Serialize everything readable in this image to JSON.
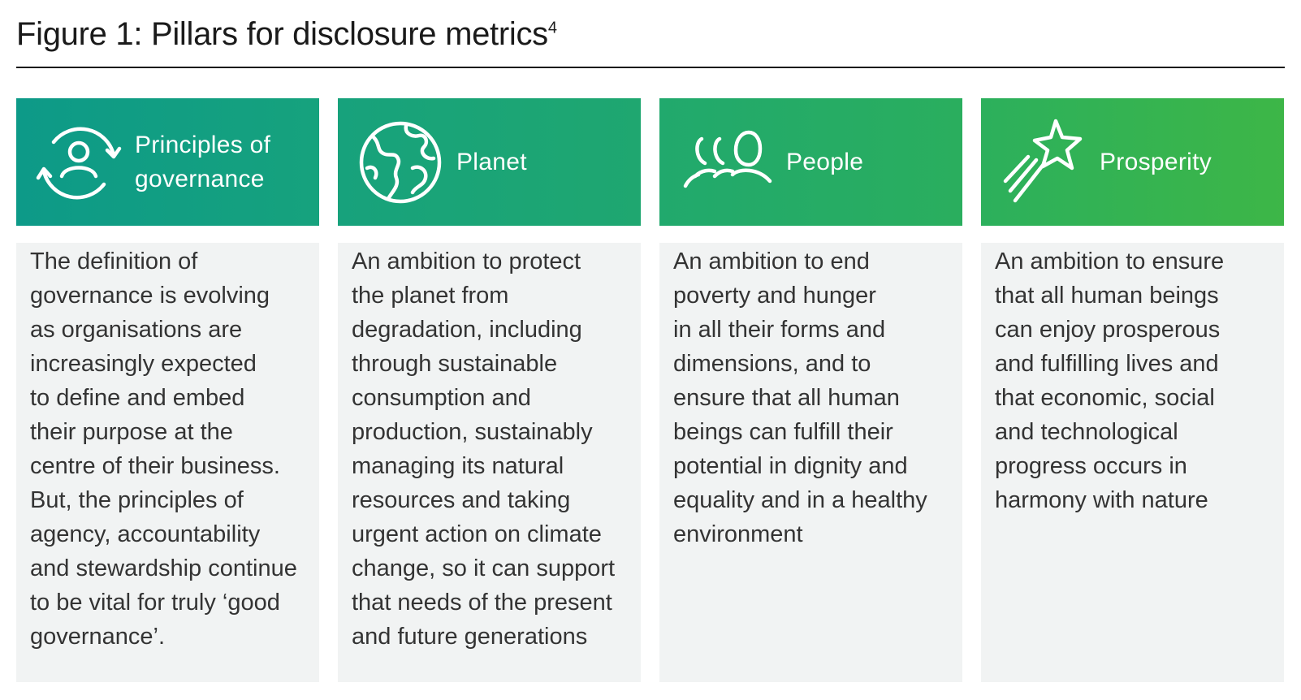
{
  "figure": {
    "title": "Figure 1: Pillars for disclosure metrics",
    "footnote_marker": "4"
  },
  "pillars": [
    {
      "heading": "Principles of\ngovernance",
      "icon": "people-cycle-icon",
      "description": "The definition of\ngovernance is evolving\nas organisations are\nincreasingly expected\nto define and embed\ntheir purpose at the\ncentre of their business.\nBut, the principles of\nagency, accountability\nand stewardship continue\nto be vital for truly ‘good\ngovernance’."
    },
    {
      "heading": "Planet",
      "icon": "globe-icon",
      "description": "An ambition to protect\nthe planet from\ndegradation, including\nthrough sustainable\nconsumption and\nproduction, sustainably\nmanaging its natural\nresources and taking\nurgent action on climate\nchange, so it can support\nthat needs of the present\nand future generations"
    },
    {
      "heading": "People",
      "icon": "people-group-icon",
      "description": "An ambition to end\npoverty and hunger\nin all their forms and\ndimensions, and to\nensure that all human\nbeings can fulfill their\npotential in dignity and\nequality and in a healthy\nenvironment"
    },
    {
      "heading": "Prosperity",
      "icon": "shooting-star-icon",
      "description": "An ambition to ensure\nthat all human beings\ncan enjoy prosperous\nand fulfilling lives and\nthat economic, social\nand technological\nprogress occurs in\nharmony with nature"
    }
  ],
  "colors": {
    "governance": "#0d9a88",
    "planet": "#1fa770",
    "people": "#2aae5e",
    "prosperity": "#3db647",
    "body_background": "#f1f3f3"
  }
}
